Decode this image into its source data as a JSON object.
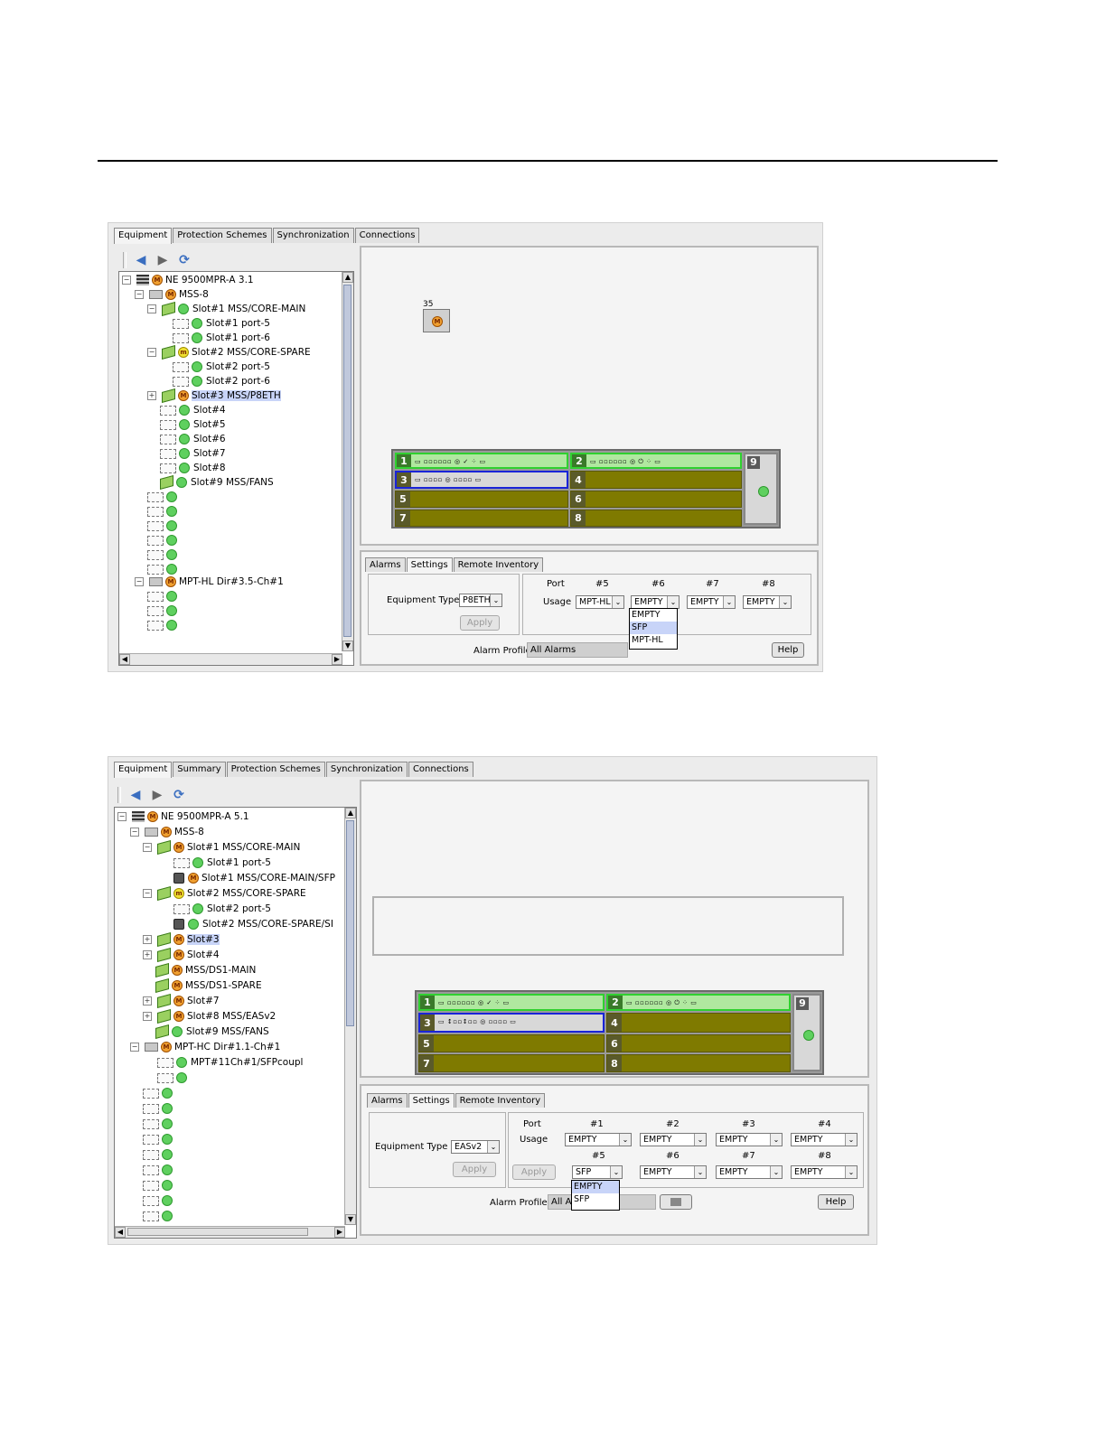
{
  "shot1": {
    "tabs": [
      "Equipment",
      "Protection Schemes",
      "Synchronization",
      "Connections"
    ],
    "toolbar": {
      "back_icon": "back-arrow-icon",
      "forward_icon": "forward-arrow-icon",
      "refresh_icon": "refresh-icon"
    },
    "tree": [
      {
        "text": "NE 9500MPR-A 3.1"
      },
      {
        "text": "MSS-8"
      },
      {
        "text": "Slot#1 MSS/CORE-MAIN"
      },
      {
        "text": "Slot#1  port-5"
      },
      {
        "text": "Slot#1  port-6"
      },
      {
        "text": "Slot#2 MSS/CORE-SPARE"
      },
      {
        "text": "Slot#2  port-5"
      },
      {
        "text": "Slot#2  port-6"
      },
      {
        "text": "Slot#3 MSS/P8ETH"
      },
      {
        "text": "Slot#4"
      },
      {
        "text": "Slot#5"
      },
      {
        "text": "Slot#6"
      },
      {
        "text": "Slot#7"
      },
      {
        "text": "Slot#8"
      },
      {
        "text": "Slot#9 MSS/FANS"
      },
      {
        "text": "MPT-HL Dir#3.5-Ch#1"
      }
    ],
    "node_label": "35",
    "chassis_slots": [
      "1",
      "2",
      "3",
      "4",
      "5",
      "6",
      "7",
      "8",
      "9"
    ],
    "bottom_tabs": [
      "Alarms",
      "Settings",
      "Remote Inventory"
    ],
    "equipment_type_label": "Equipment Type",
    "equipment_type_value": "P8ETH",
    "apply_label": "Apply",
    "port_label": "Port",
    "usage_label": "Usage",
    "ports": [
      "#5",
      "#6",
      "#7",
      "#8"
    ],
    "usages": [
      "MPT-HL",
      "EMPTY",
      "EMPTY",
      "EMPTY"
    ],
    "dropdown_options": [
      "EMPTY",
      "SFP",
      "MPT-HL"
    ],
    "alarm_profile_label": "Alarm Profile",
    "alarm_profile_value": "All Alarms",
    "help_label": "Help"
  },
  "shot2": {
    "tabs": [
      "Equipment",
      "Summary",
      "Protection Schemes",
      "Synchronization",
      "Connections"
    ],
    "tree": [
      {
        "text": "NE 9500MPR-A 5.1"
      },
      {
        "text": "MSS-8"
      },
      {
        "text": "Slot#1 MSS/CORE-MAIN"
      },
      {
        "text": "Slot#1  port-5"
      },
      {
        "text": "Slot#1 MSS/CORE-MAIN/SFP"
      },
      {
        "text": "Slot#2 MSS/CORE-SPARE"
      },
      {
        "text": "Slot#2  port-5"
      },
      {
        "text": "Slot#2 MSS/CORE-SPARE/SI"
      },
      {
        "text": "Slot#3"
      },
      {
        "text": "Slot#4"
      },
      {
        "text": "MSS/DS1-MAIN"
      },
      {
        "text": "MSS/DS1-SPARE"
      },
      {
        "text": "Slot#7"
      },
      {
        "text": "Slot#8 MSS/EASv2"
      },
      {
        "text": "Slot#9 MSS/FANS"
      },
      {
        "text": "MPT-HC Dir#1.1-Ch#1"
      },
      {
        "text": "MPT#11Ch#1/SFPcoupl"
      }
    ],
    "chassis_slots": [
      "1",
      "2",
      "3",
      "4",
      "5",
      "6",
      "7",
      "8",
      "9"
    ],
    "bottom_tabs": [
      "Alarms",
      "Settings",
      "Remote Inventory"
    ],
    "equipment_type_label": "Equipment Type",
    "equipment_type_value": "EASv2",
    "apply_label": "Apply",
    "port_label": "Port",
    "usage_label": "Usage",
    "ports_row1": [
      "#1",
      "#2",
      "#3",
      "#4"
    ],
    "usages_row1": [
      "EMPTY",
      "EMPTY",
      "EMPTY",
      "EMPTY"
    ],
    "ports_row2": [
      "#5",
      "#6",
      "#7",
      "#8"
    ],
    "usages_row2": [
      "SFP",
      "EMPTY",
      "EMPTY",
      "EMPTY"
    ],
    "dropdown_options": [
      "EMPTY",
      "SFP"
    ],
    "alarm_profile_label": "Alarm Profile",
    "alarm_profile_value": "All A",
    "help_label": "Help"
  }
}
